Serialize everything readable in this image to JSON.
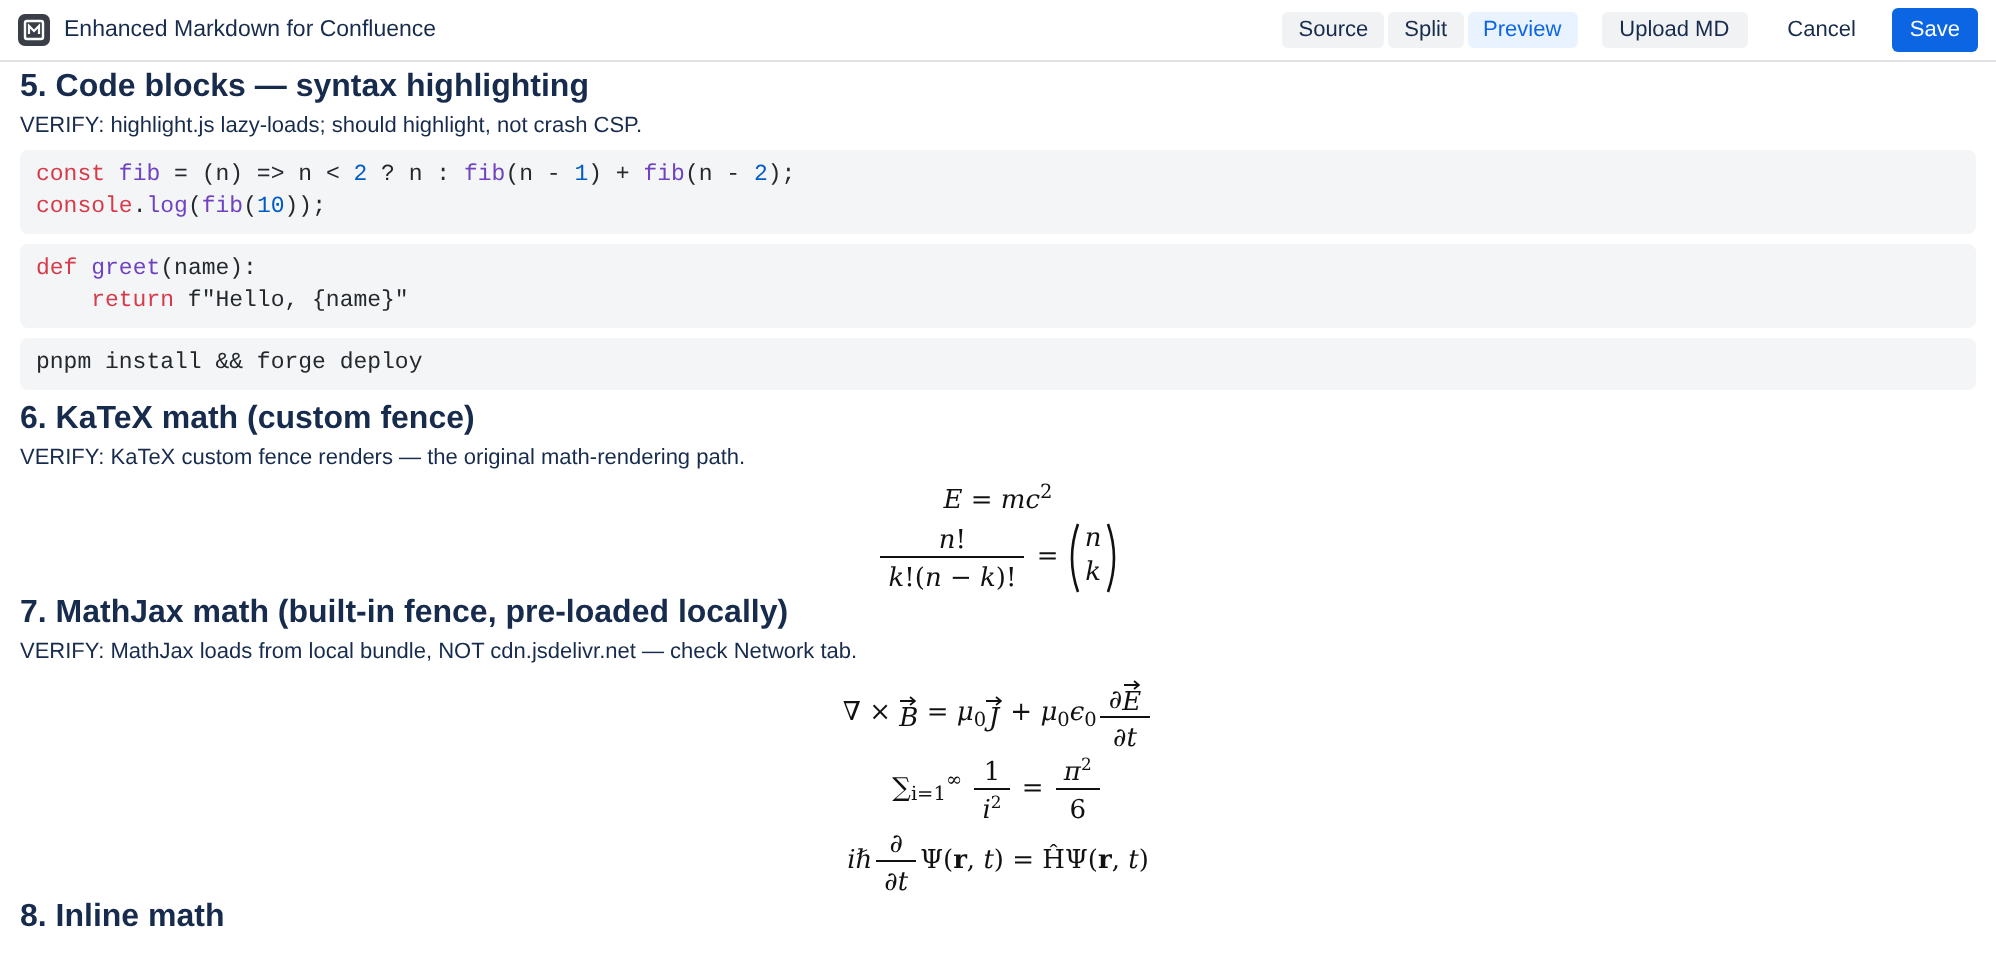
{
  "header": {
    "title": "Enhanced Markdown for Confluence",
    "view_tabs": [
      {
        "label": "Source",
        "selected": false
      },
      {
        "label": "Split",
        "selected": false
      },
      {
        "label": "Preview",
        "selected": true
      }
    ],
    "buttons": [
      {
        "label": "Upload MD",
        "kind": "secondary"
      },
      {
        "label": "Cancel",
        "kind": "subtle"
      },
      {
        "label": "Save",
        "kind": "primary"
      }
    ]
  },
  "sections": [
    {
      "heading": "5. Code blocks — syntax highlighting",
      "note": "VERIFY: highlight.js lazy-loads; should highlight, not crash CSP.",
      "blocks": [
        {
          "kind": "code",
          "lines": [
            [
              {
                "kind": "keyword",
                "text": "const"
              },
              {
                "kind": "func",
                "text": " fib"
              },
              {
                "kind": "plain",
                "text": " = (n) => n < "
              },
              {
                "kind": "number",
                "text": "2"
              },
              {
                "kind": "plain",
                "text": " ? n : "
              },
              {
                "kind": "func",
                "text": "fib"
              },
              {
                "kind": "plain",
                "text": "(n - "
              },
              {
                "kind": "number",
                "text": "1"
              },
              {
                "kind": "plain",
                "text": ") + "
              },
              {
                "kind": "func",
                "text": "fib"
              },
              {
                "kind": "plain",
                "text": "(n - "
              },
              {
                "kind": "number",
                "text": "2"
              },
              {
                "kind": "plain",
                "text": ");"
              }
            ],
            [
              {
                "kind": "keyword",
                "text": "console"
              },
              {
                "kind": "plain",
                "text": "."
              },
              {
                "kind": "func",
                "text": "log"
              },
              {
                "kind": "plain",
                "text": "("
              },
              {
                "kind": "func",
                "text": "fib"
              },
              {
                "kind": "plain",
                "text": "("
              },
              {
                "kind": "number",
                "text": "10"
              },
              {
                "kind": "plain",
                "text": "));"
              }
            ]
          ]
        },
        {
          "kind": "code",
          "lines": [
            [
              {
                "kind": "keyword",
                "text": "def"
              },
              {
                "kind": "func",
                "text": " greet"
              },
              {
                "kind": "plain",
                "text": "(name):"
              }
            ],
            [
              {
                "kind": "keyword",
                "text": "    return"
              },
              {
                "kind": "plain",
                "text": " f\"Hello, {name}\""
              }
            ]
          ]
        },
        {
          "kind": "code",
          "lines": [
            [
              {
                "kind": "plain",
                "text": "pnpm install && forge deploy"
              }
            ]
          ]
        }
      ]
    },
    {
      "heading": "6. KaTeX math (custom fence)",
      "note": "VERIFY: KaTeX custom fence renders — the original math-rendering path.",
      "blocks": [
        {
          "kind": "math",
          "parts": [
            {
              "kind": "text",
              "text": "*E* = *mc*$^{2}$"
            }
          ]
        },
        {
          "kind": "math",
          "parts": [
            {
              "kind": "frac",
              "num": [
                {
                  "kind": "text",
                  "text": "*n*!"
                }
              ],
              "den": [
                {
                  "kind": "text",
                  "text": "*k*!(*n* − *k*)!"
                }
              ]
            },
            {
              "kind": "text",
              "text": " = "
            },
            {
              "kind": "binom",
              "top": "*n*",
              "bottom": "*k*"
            }
          ]
        }
      ]
    },
    {
      "heading": "7. MathJax math (built-in fence, pre-loaded locally)",
      "note": "VERIFY: MathJax loads from local bundle, NOT cdn.jsdelivr.net — check Network tab.",
      "blocks": [
        {
          "kind": "math",
          "parts": [
            {
              "kind": "text",
              "text": "∇ × "
            },
            {
              "kind": "vec",
              "text": "B"
            },
            {
              "kind": "text",
              "text": " = *μ*$_{0}$"
            },
            {
              "kind": "vec",
              "text": "J"
            },
            {
              "kind": "text",
              "text": " + *μ*$_{0}$*ϵ*$_{0}$"
            },
            {
              "kind": "frac",
              "num": [
                {
                  "kind": "text",
                  "text": "∂"
                },
                {
                  "kind": "vec",
                  "text": "E"
                }
              ],
              "den": [
                {
                  "kind": "text",
                  "text": "∂*t*"
                }
              ]
            }
          ]
        },
        {
          "kind": "math",
          "parts": [
            {
              "kind": "text",
              "text": "∑$_{i=1}$$^{∞}$ "
            },
            {
              "kind": "frac",
              "num": [
                {
                  "kind": "text",
                  "text": "1"
                }
              ],
              "den": [
                {
                  "kind": "text",
                  "text": "*i*$^{2}$"
                }
              ]
            },
            {
              "kind": "text",
              "text": " = "
            },
            {
              "kind": "frac",
              "num": [
                {
                  "kind": "text",
                  "text": "*π*$^{2}$"
                }
              ],
              "den": [
                {
                  "kind": "text",
                  "text": "6"
                }
              ]
            }
          ]
        },
        {
          "kind": "math",
          "parts": [
            {
              "kind": "text",
              "text": "*iℏ*"
            },
            {
              "kind": "frac",
              "num": [
                {
                  "kind": "text",
                  "text": "∂"
                }
              ],
              "den": [
                {
                  "kind": "text",
                  "text": "∂*t*"
                }
              ]
            },
            {
              "kind": "text",
              "text": "Ψ(**r**, *t*) = ĤΨ(**r**, *t*)"
            }
          ]
        }
      ]
    },
    {
      "heading": "8. Inline math"
    }
  ]
}
